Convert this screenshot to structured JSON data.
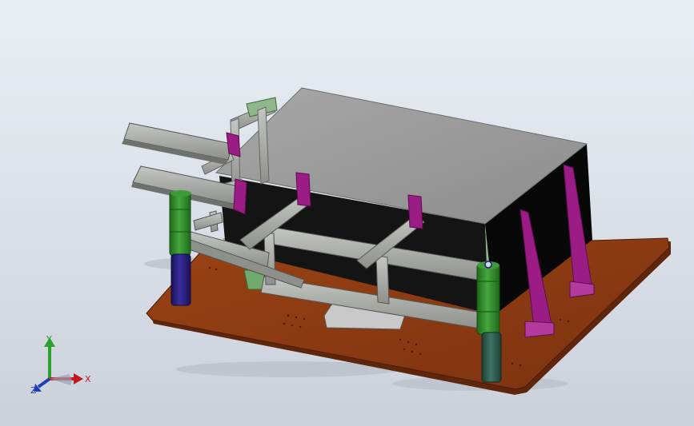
{
  "viewport": {
    "background_top": "#e9edf4",
    "background_bottom": "#cbd1db"
  },
  "colors": {
    "base_plate": "#8b3a12",
    "base_plate_edge": "#5e260b",
    "mold_block_top": "#9c9c9c",
    "mold_block_side": "#0d0d0d",
    "frame_steel": "#a6a8a4",
    "gusset_magenta": "#9c1c86",
    "column_green": "#2f8a2a",
    "column_blue": "#2a1f7e",
    "column_teal": "#2d5b4e",
    "pad_green": "#8fb78b"
  },
  "triad": {
    "x_label": "X",
    "y_label": "Y",
    "z_label": "Z",
    "x_color": "#c0191f",
    "y_color": "#2ca02c",
    "z_color": "#1f3fb4"
  }
}
